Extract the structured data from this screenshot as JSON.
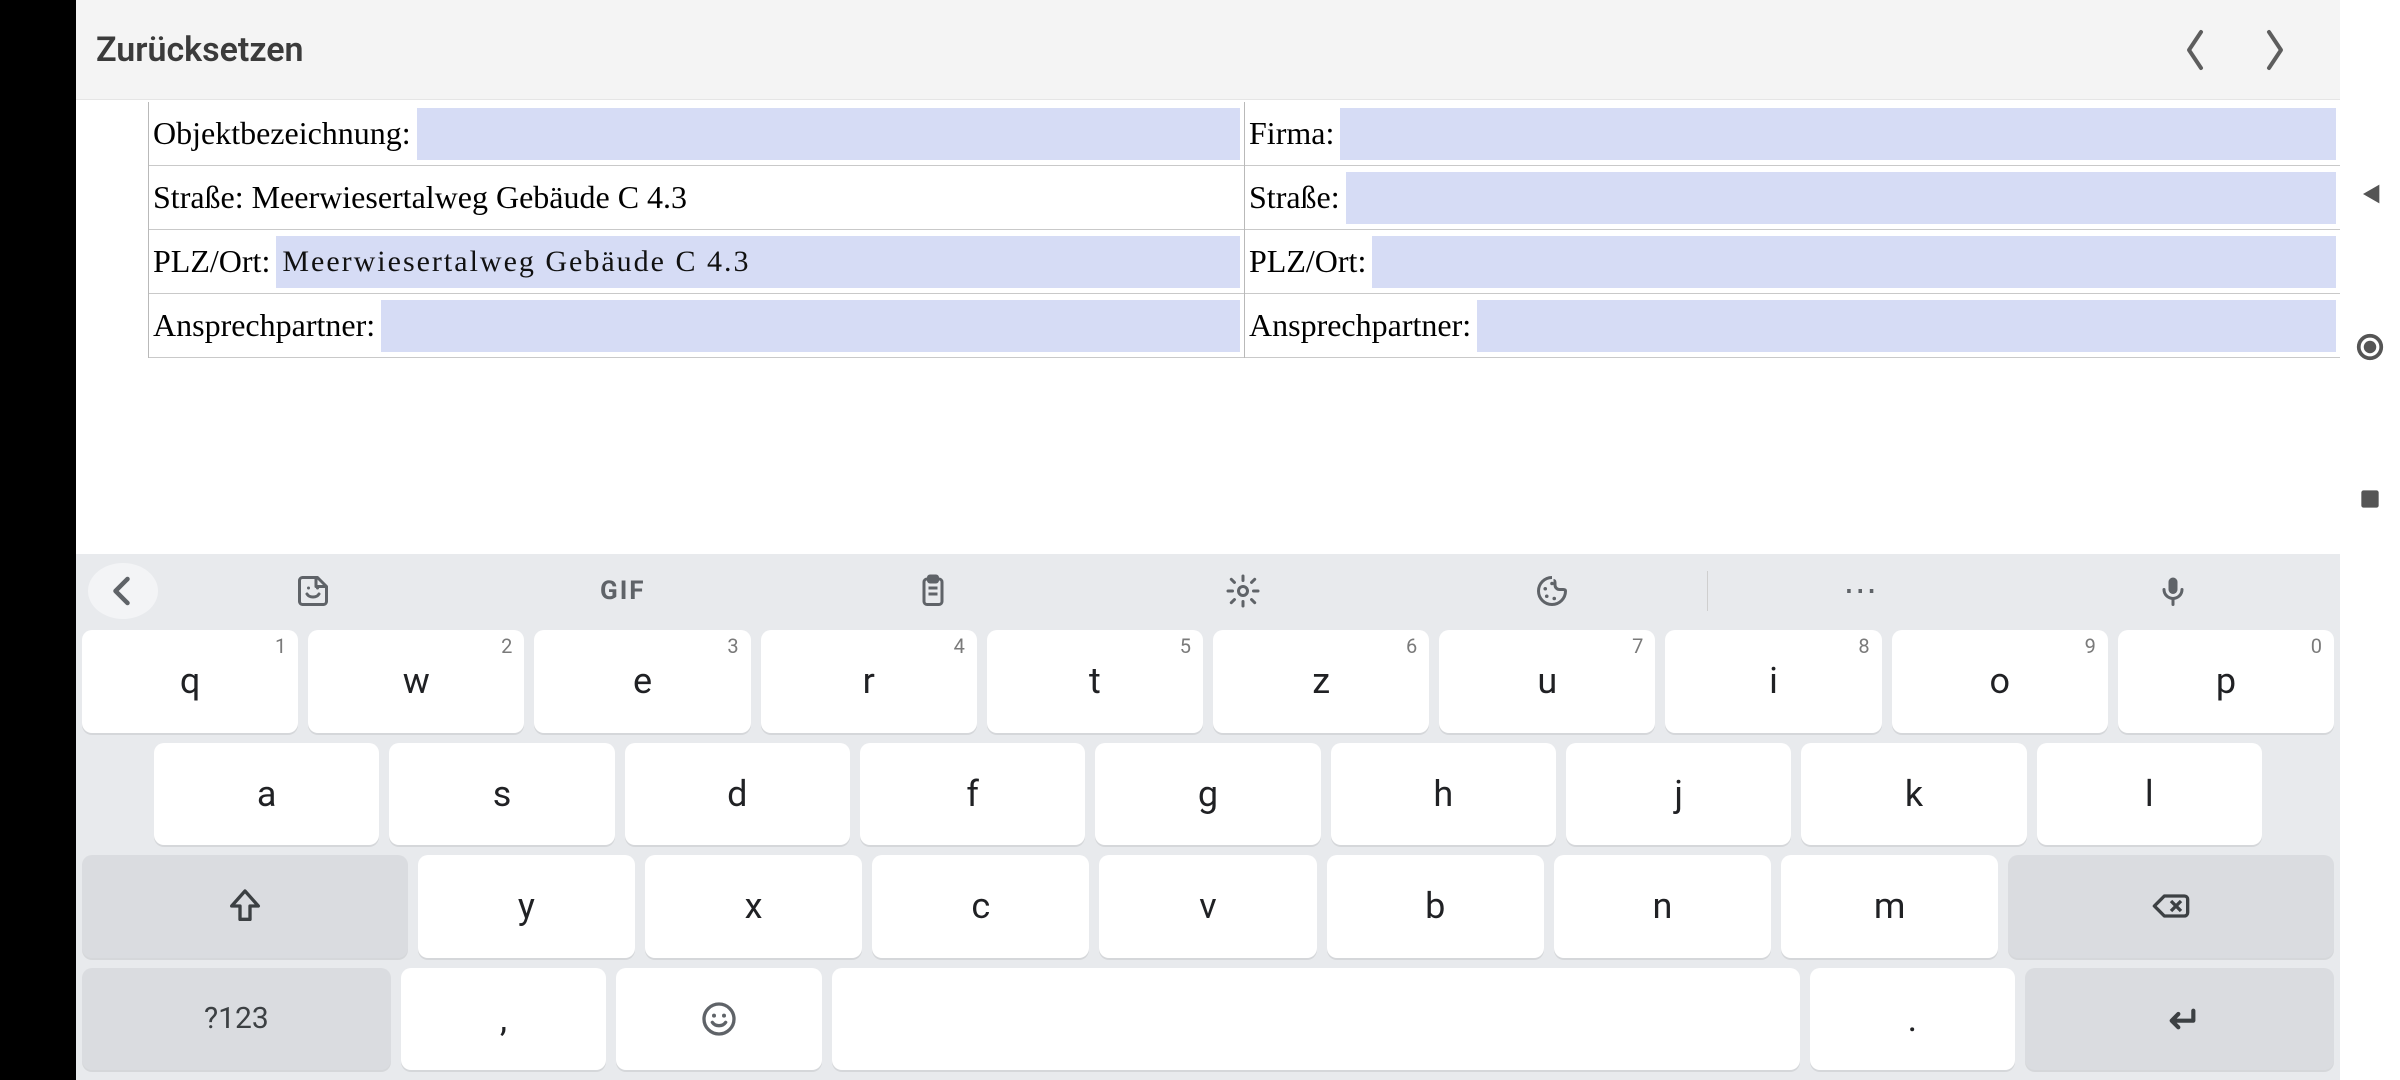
{
  "header": {
    "title": "Zurücksetzen"
  },
  "form": {
    "left": {
      "objekt_label": "Objektbezeichnung:",
      "objekt_value": "",
      "strasse_label": "Straße:",
      "strasse_value": "Meerwiesertalweg  Gebäude C 4.3",
      "plzort_label": "PLZ/Ort:",
      "plzort_value": "Meerwiesertalweg  Gebäude C 4.3",
      "ansprech_label": "Ansprechpartner:",
      "ansprech_value": ""
    },
    "right": {
      "firma_label": "Firma:",
      "firma_value": "",
      "strasse_label": "Straße:",
      "strasse_value": "",
      "plzort_label": "PLZ/Ort:",
      "plzort_value": "",
      "ansprech_label": "Ansprechpartner:",
      "ansprech_value": ""
    }
  },
  "keyboard": {
    "toolbar": {
      "gif": "GIF",
      "more": "⋯"
    },
    "row1": [
      {
        "k": "q",
        "h": "1"
      },
      {
        "k": "w",
        "h": "2"
      },
      {
        "k": "e",
        "h": "3"
      },
      {
        "k": "r",
        "h": "4"
      },
      {
        "k": "t",
        "h": "5"
      },
      {
        "k": "z",
        "h": "6"
      },
      {
        "k": "u",
        "h": "7"
      },
      {
        "k": "i",
        "h": "8"
      },
      {
        "k": "o",
        "h": "9"
      },
      {
        "k": "p",
        "h": "0"
      }
    ],
    "row2": [
      {
        "k": "a"
      },
      {
        "k": "s"
      },
      {
        "k": "d"
      },
      {
        "k": "f"
      },
      {
        "k": "g"
      },
      {
        "k": "h"
      },
      {
        "k": "j"
      },
      {
        "k": "k"
      },
      {
        "k": "l"
      }
    ],
    "row3_letters": [
      {
        "k": "y"
      },
      {
        "k": "x"
      },
      {
        "k": "c"
      },
      {
        "k": "v"
      },
      {
        "k": "b"
      },
      {
        "k": "n"
      },
      {
        "k": "m"
      }
    ],
    "symbols_label": "?123",
    "comma": ",",
    "period": "."
  }
}
